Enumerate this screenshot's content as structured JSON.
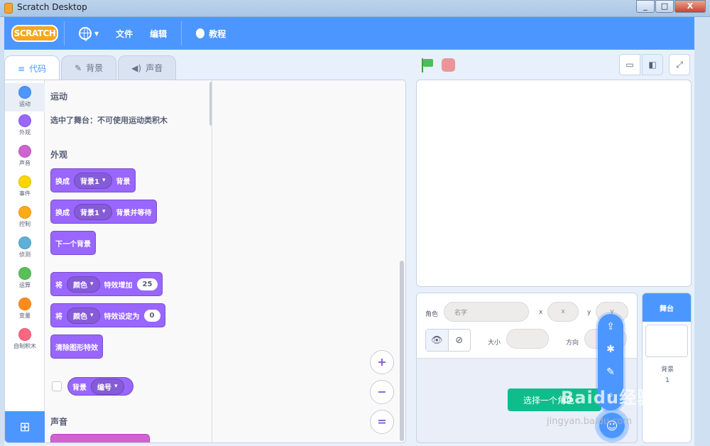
{
  "window": {
    "title": "Scratch Desktop",
    "minimize": "_",
    "maximize": "□",
    "close": "X"
  },
  "menubar": {
    "logo": "SCRATCH",
    "file": "文件",
    "edit": "编辑",
    "tutorials": "教程"
  },
  "tabs": [
    {
      "label": "代码",
      "icon": "code-icon"
    },
    {
      "label": "背景",
      "icon": "brush-icon"
    },
    {
      "label": "声音",
      "icon": "speaker-icon"
    }
  ],
  "categories": [
    {
      "label": "运动",
      "color": "#4c97ff"
    },
    {
      "label": "外观",
      "color": "#9966ff"
    },
    {
      "label": "声音",
      "color": "#cf63cf"
    },
    {
      "label": "事件",
      "color": "#ffd500"
    },
    {
      "label": "控制",
      "color": "#ffab19"
    },
    {
      "label": "侦测",
      "color": "#5cb1d6"
    },
    {
      "label": "运算",
      "color": "#59c059"
    },
    {
      "label": "变量",
      "color": "#ff8c1a"
    },
    {
      "label": "自制积木",
      "color": "#ff6680"
    }
  ],
  "palette": {
    "motion_title": "运动",
    "motion_note": "选中了舞台：不可使用运动类积木",
    "looks_title": "外观",
    "sound_title": "声音",
    "blocks": {
      "b1": {
        "a": "换成",
        "dd": "背景1",
        "b": "背景"
      },
      "b2": {
        "a": "换成",
        "dd": "背景1",
        "b": "背景并等待"
      },
      "b3": {
        "a": "下一个背景"
      },
      "b4": {
        "a": "将",
        "dd": "颜色",
        "b": "特效增加",
        "num": "25"
      },
      "b5": {
        "a": "将",
        "dd": "颜色",
        "b": "特效设定为",
        "num": "0"
      },
      "b6": {
        "a": "清除图形特效"
      },
      "b7": {
        "a": "背景",
        "dd": "编号"
      }
    }
  },
  "zoom": {
    "in": "+",
    "out": "−",
    "reset": "="
  },
  "sprite_info": {
    "sprite_label": "角色",
    "name_placeholder": "名字",
    "x_label": "x",
    "x_placeholder": "x",
    "y_label": "y",
    "y_placeholder": "y",
    "size_label": "大小",
    "direction_label": "方向",
    "show_icon": "👁",
    "hide_icon": "⊘"
  },
  "choose_sprite": "选择一个角色",
  "stage_pane": {
    "title": "舞台",
    "bg_label": "背景",
    "bg_count": "1"
  },
  "colors": {
    "accent": "#4c97ff",
    "looks": "#9966ff",
    "green": "#0fbd8c"
  },
  "watermark": {
    "brand": "Baidu经验",
    "url": "jingyan.baidu.com"
  }
}
